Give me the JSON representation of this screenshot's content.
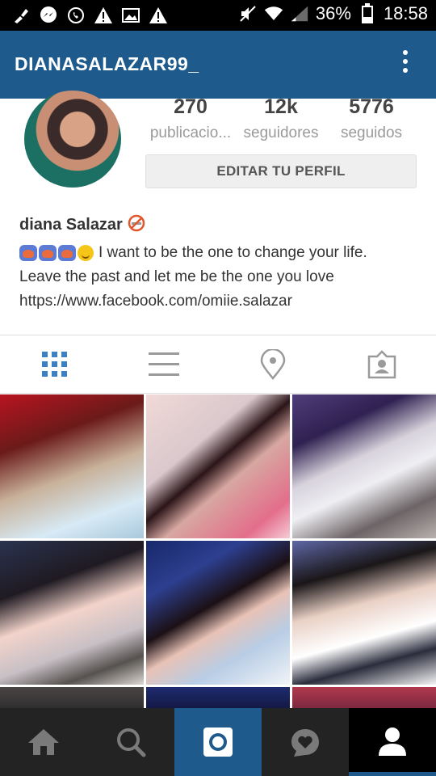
{
  "status_bar": {
    "battery": "36%",
    "time": "18:58",
    "icons_left": [
      "brush-icon",
      "messenger-icon",
      "whatsapp-icon",
      "warning-icon",
      "image-icon",
      "warning-icon"
    ],
    "icons_right": [
      "mute-icon",
      "wifi-icon",
      "signal-icon",
      "battery-icon"
    ]
  },
  "app_bar": {
    "title": "DIANASALAZAR99_"
  },
  "profile": {
    "stats": [
      {
        "value": "270",
        "label": "publicacio..."
      },
      {
        "value": "12k",
        "label": "seguidores"
      },
      {
        "value": "5776",
        "label": "seguidos"
      }
    ],
    "edit_button": "EDITAR TU PERFIL",
    "name": "diana Salazar",
    "bio_line1": "I want to be the one to change your life.",
    "bio_line2": "Leave the past and let me be the one you love",
    "bio_link": "https://www.facebook.com/omiie.salazar"
  },
  "tabs": [
    "grid-icon",
    "list-icon",
    "location-icon",
    "tagged-icon"
  ],
  "bottom_nav": [
    "home-icon",
    "search-icon",
    "camera-icon",
    "activity-icon",
    "profile-icon"
  ],
  "colors": {
    "brand_blue": "#1f5a8d",
    "grid_blue": "#3b7fc4",
    "nav_dark": "#232323"
  }
}
